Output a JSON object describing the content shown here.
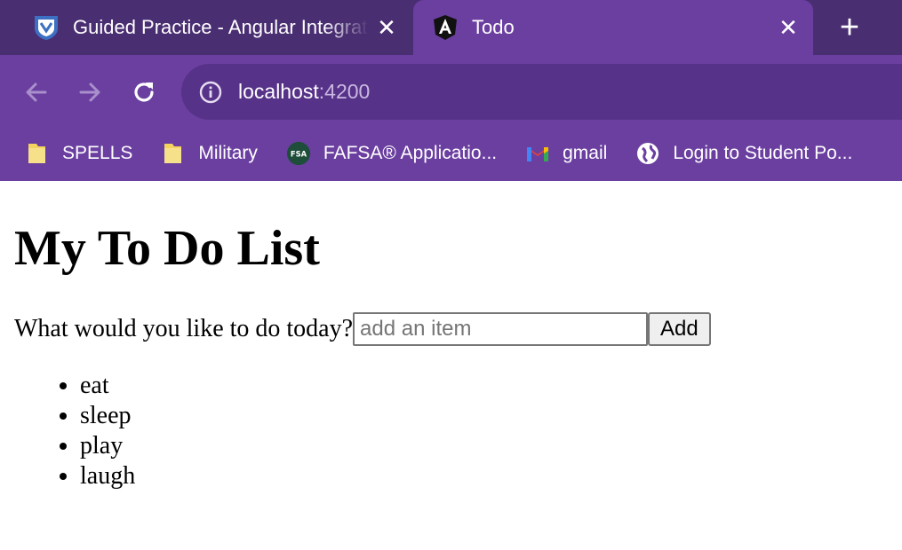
{
  "browser": {
    "tabs": [
      {
        "title": "Guided Practice - Angular Integration",
        "icon": "shield-icon",
        "active": false
      },
      {
        "title": "Todo",
        "icon": "angular-icon",
        "active": true
      }
    ],
    "close_glyph": "✕",
    "new_tab_glyph": "+",
    "url_host": "localhost",
    "url_port": ":4200",
    "bookmarks": [
      {
        "label": "SPELLS",
        "icon": "folder-icon"
      },
      {
        "label": "Military",
        "icon": "folder-icon"
      },
      {
        "label": "FAFSA® Applicatio...",
        "icon": "fsa-icon"
      },
      {
        "label": "gmail",
        "icon": "gmail-icon"
      },
      {
        "label": "Login to Student Po...",
        "icon": "globe-icon"
      }
    ],
    "colors": {
      "tabstrip": "#4a2e72",
      "toolbar": "#6b3fa0",
      "omnibox": "#573289"
    }
  },
  "page": {
    "heading": "My To Do List",
    "prompt": "What would you like to do today?",
    "input_placeholder": "add an item",
    "input_value": "",
    "add_label": "Add",
    "items": [
      "eat",
      "sleep",
      "play",
      "laugh"
    ]
  }
}
